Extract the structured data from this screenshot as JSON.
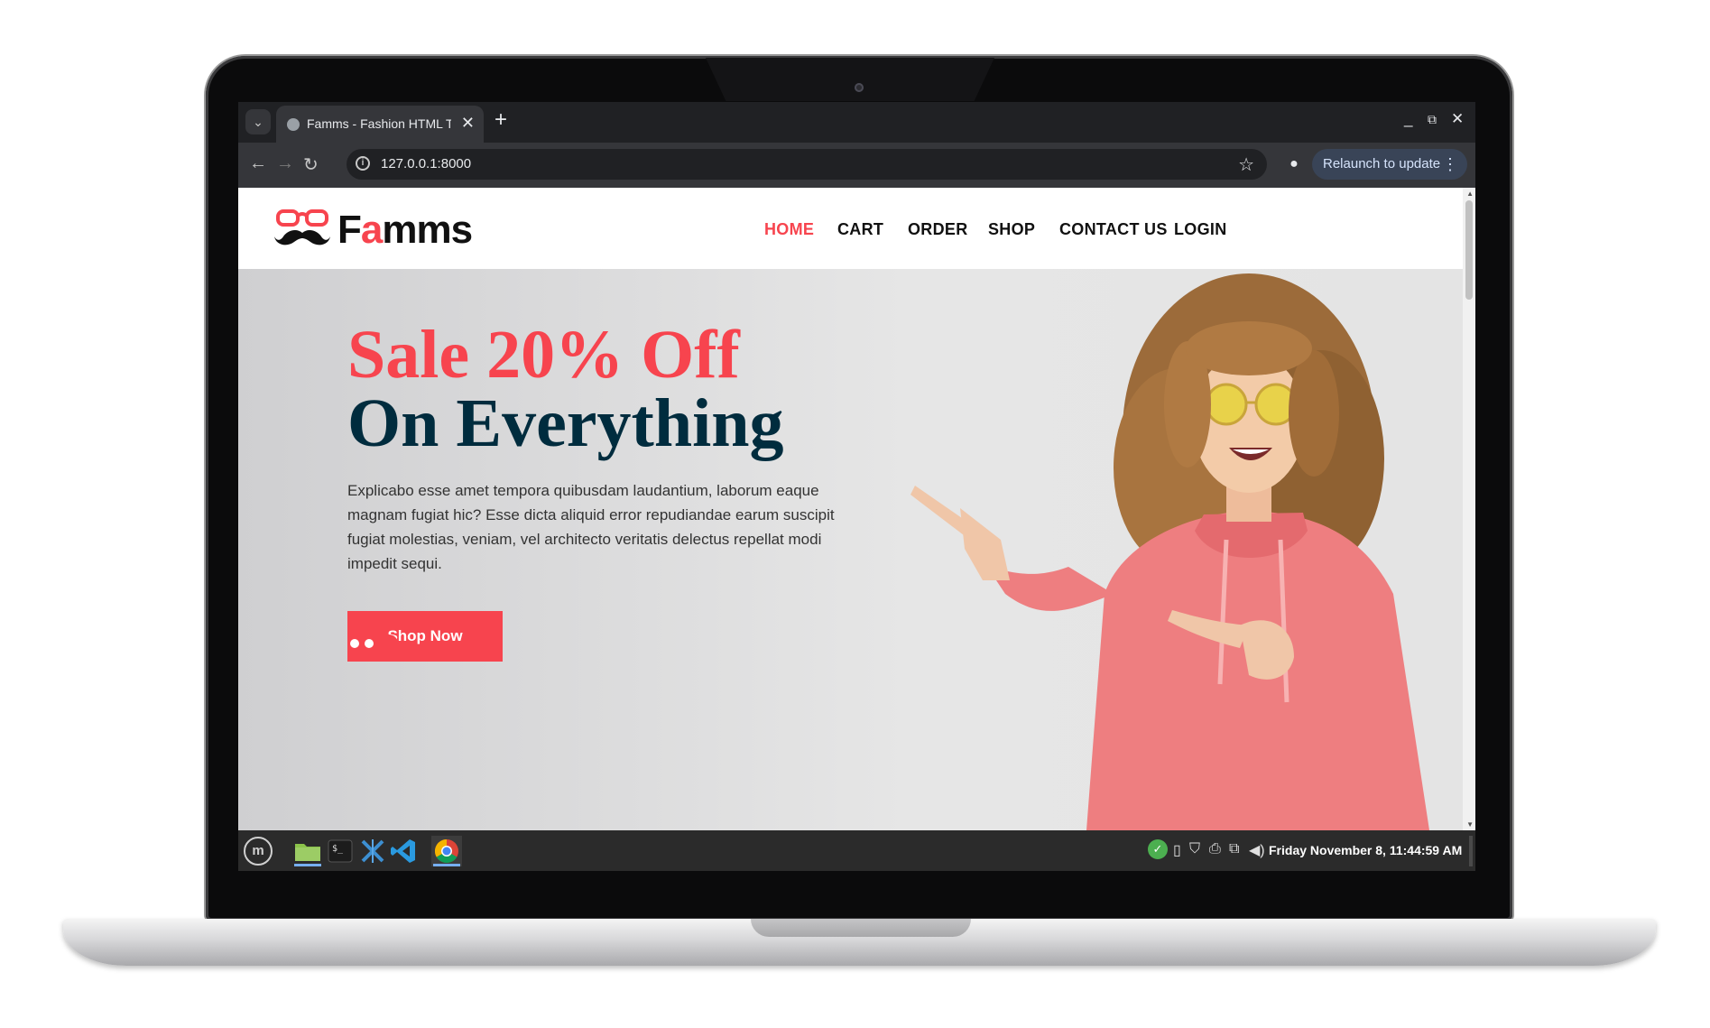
{
  "browser": {
    "tab_title": "Famms - Fashion HTML Temp",
    "tab_close": "✕",
    "new_tab": "+",
    "url": "127.0.0.1:8000",
    "relaunch_label": "Relaunch to update",
    "window_controls": {
      "minimize": "_",
      "restore": "⧉",
      "close": "✕"
    }
  },
  "site": {
    "logo_prefix": "F",
    "logo_accent": "a",
    "logo_suffix": "mms",
    "nav": [
      "HOME",
      "CART",
      "ORDER",
      "SHOP",
      "CONTACT US",
      "LOGIN"
    ],
    "active_nav": "HOME",
    "hero": {
      "title_line1": "Sale 20% Off",
      "title_line2": "On Everything",
      "description": "Explicabo esse amet tempora quibusdam laudantium, laborum eaque magnam fugiat hic? Esse dicta aliquid error repudiandae earum suscipit fugiat molestias, veniam, vel architecto veritatis delectus repellat modi impedit sequi.",
      "button_label": "Shop Now",
      "slides_total": 3,
      "active_slide": 3
    }
  },
  "taskbar": {
    "clock": "Friday November  8, 11:44:59 AM",
    "apps": [
      "files-icon",
      "terminal-icon",
      "xorg-icon",
      "vscode-icon",
      "chrome-icon"
    ]
  },
  "colors": {
    "accent": "#f7444e",
    "navy": "#002c3e",
    "browser_dark": "#202124",
    "browser_toolbar": "#35363a"
  }
}
